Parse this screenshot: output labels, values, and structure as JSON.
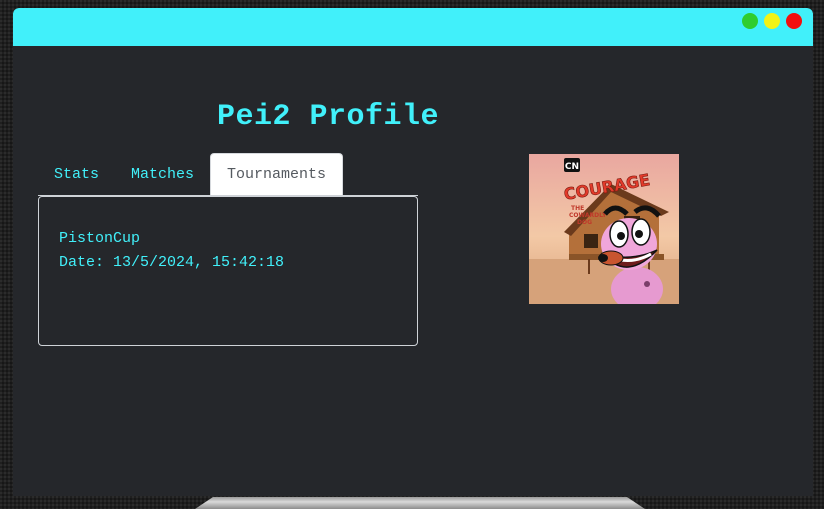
{
  "window": {
    "controls": [
      {
        "name": "maximize",
        "color": "#2fcd2f"
      },
      {
        "name": "minimize",
        "color": "#f3f316"
      },
      {
        "name": "close",
        "color": "#f30e0e"
      }
    ],
    "accent": "#41f0fa",
    "background": "#25272b"
  },
  "profile": {
    "title": "Pei2 Profile",
    "avatar_icon": "cartoon-dog-avatar",
    "avatar_text": {
      "logo": "CN",
      "title": "COURAGE",
      "subtitle_line1": "THE",
      "subtitle_line2": "COWARDLY",
      "subtitle_line3": "DOG"
    }
  },
  "tabs": [
    {
      "label": "Stats",
      "active": false
    },
    {
      "label": "Matches",
      "active": false
    },
    {
      "label": "Tournaments",
      "active": true
    }
  ],
  "tournament": {
    "name": "PistonCup",
    "date_line": "Date: 13/5/2024, 15:42:18"
  }
}
